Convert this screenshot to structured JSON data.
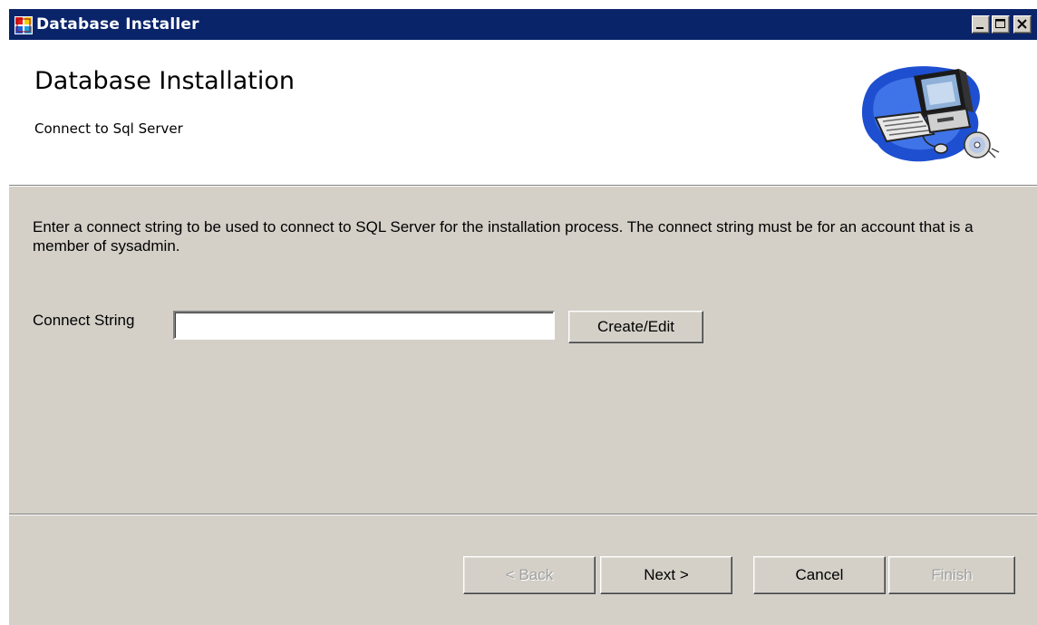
{
  "window": {
    "title": "Database Installer",
    "icon": "installer-app-icon",
    "controls": [
      "minimize-icon",
      "maximize-icon",
      "close-icon"
    ]
  },
  "header": {
    "title": "Database Installation",
    "subtitle": "Connect to Sql Server",
    "image": "computer-clipart-icon"
  },
  "main": {
    "description": "Enter a connect string to be used to connect to SQL Server for the installation process. The connect string must be for an account that is a member of sysadmin.",
    "connect_string": {
      "label": "Connect String",
      "value": "",
      "button_label": "Create/Edit"
    }
  },
  "footer": {
    "back_label": "< Back",
    "next_label": "Next >",
    "cancel_label": "Cancel",
    "finish_label": "Finish",
    "back_enabled": false,
    "finish_enabled": false
  },
  "colors": {
    "titlebar": "#0a246a",
    "dialog_face": "#d4d0c8",
    "header_bg": "#ffffff",
    "disabled_text": "#a0a0a0"
  }
}
